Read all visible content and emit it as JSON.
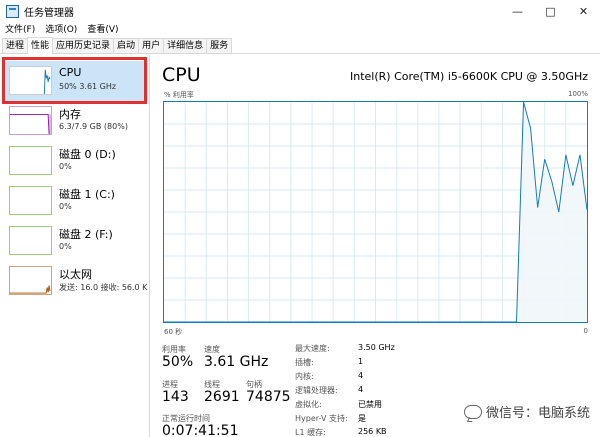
{
  "window": {
    "title": "任务管理器",
    "controls": {
      "minimize": "—",
      "maximize": "□",
      "close": "✕"
    }
  },
  "menu": [
    "文件(F)",
    "选项(O)",
    "查看(V)"
  ],
  "tabs": [
    {
      "label": "进程",
      "active": false
    },
    {
      "label": "性能",
      "active": true
    },
    {
      "label": "应用历史记录",
      "active": false
    },
    {
      "label": "启动",
      "active": false
    },
    {
      "label": "用户",
      "active": false
    },
    {
      "label": "详细信息",
      "active": false
    },
    {
      "label": "服务",
      "active": false
    }
  ],
  "sidebar": {
    "items": [
      {
        "name": "CPU",
        "sub": "50% 3.61 GHz",
        "color": "#117dbb",
        "selected": true
      },
      {
        "name": "内存",
        "sub": "6.3/7.9 GB (80%)",
        "color": "#8b12ae",
        "selected": false
      },
      {
        "name": "磁盘 0 (D:)",
        "sub": "0%",
        "color": "#4da60c",
        "selected": false
      },
      {
        "name": "磁盘 1 (C:)",
        "sub": "0%",
        "color": "#4da60c",
        "selected": false
      },
      {
        "name": "磁盘 2 (F:)",
        "sub": "0%",
        "color": "#4da60c",
        "selected": false
      },
      {
        "name": "以太网",
        "sub": "发送: 16.0 接收: 56.0 K",
        "color": "#a74f01",
        "selected": false
      }
    ]
  },
  "main": {
    "title": "CPU",
    "model": "Intel(R) Core(TM) i5-6600K CPU @ 3.50GHz",
    "y_axis_label": "% 利用率",
    "y_axis_max": "100%",
    "x_axis_left": "60 秒",
    "x_axis_right": "0",
    "graph_color": "#117dbb",
    "graph_fill": "#f1f6fa",
    "stats": {
      "utilization_label": "利用率",
      "utilization_value": "50%",
      "speed_label": "速度",
      "speed_value": "3.61 GHz",
      "processes_label": "进程",
      "processes_value": "143",
      "threads_label": "线程",
      "threads_value": "2691",
      "handles_label": "句柄",
      "handles_value": "74875",
      "uptime_label": "正常运行时间",
      "uptime_value": "0:07:41:51"
    },
    "details": [
      {
        "label": "最大速度:",
        "value": "3.50 GHz"
      },
      {
        "label": "插槽:",
        "value": "1"
      },
      {
        "label": "内核:",
        "value": "4"
      },
      {
        "label": "逻辑处理器:",
        "value": "4"
      },
      {
        "label": "虚拟化:",
        "value": "已禁用"
      },
      {
        "label": "Hyper-V 支持:",
        "value": "是"
      },
      {
        "label": "L1 缓存:",
        "value": "256 KB"
      }
    ]
  },
  "chart_data": {
    "type": "area",
    "x": [
      60,
      10,
      9,
      8,
      7,
      6,
      5,
      4,
      3,
      2,
      1,
      0
    ],
    "values": [
      0,
      0,
      100,
      88,
      52,
      74,
      64,
      50,
      76,
      62,
      76,
      51
    ],
    "ylim": [
      0,
      100
    ],
    "xlabel": "60 秒",
    "ylabel": "% 利用率",
    "grid": true
  },
  "watermark": "微信号：电脑系统"
}
